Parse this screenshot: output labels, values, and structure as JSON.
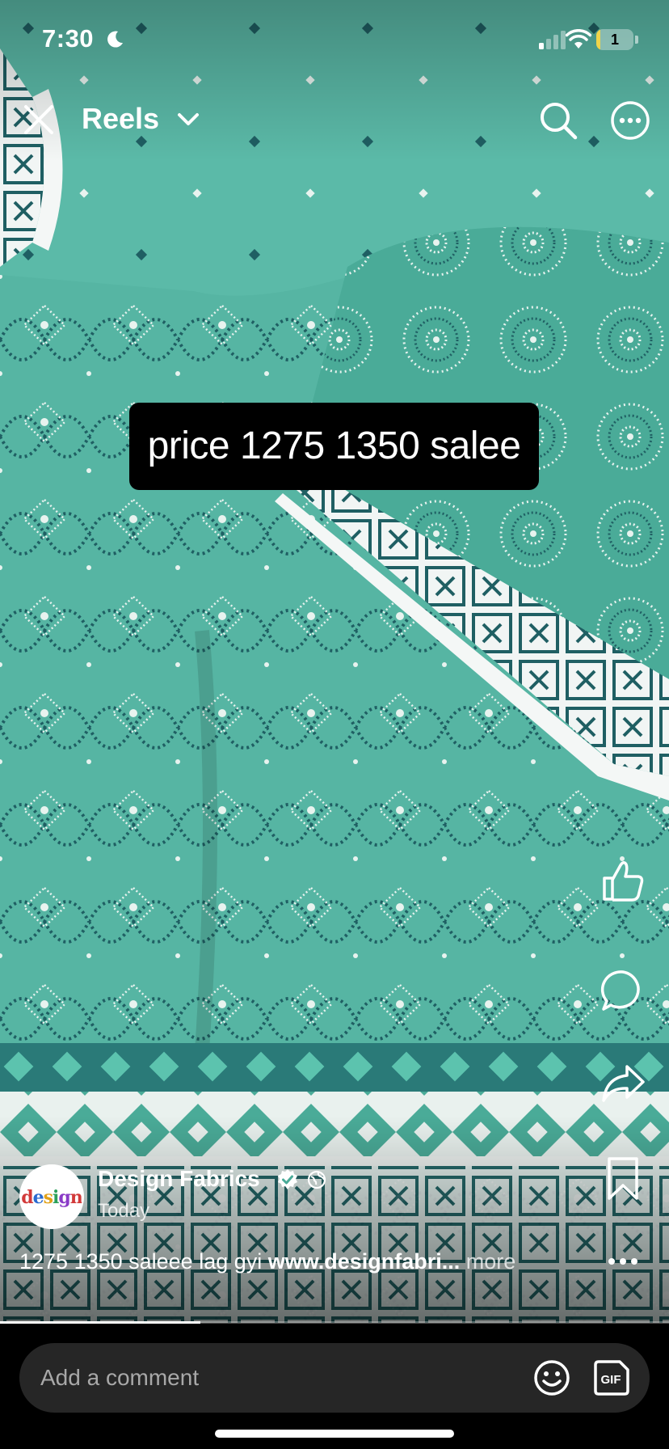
{
  "status_bar": {
    "time": "7:30",
    "battery": "1",
    "battery_level": 0.1,
    "icons": [
      "moon-icon",
      "cellular-signal-icon",
      "wifi-icon",
      "battery-icon"
    ]
  },
  "nav": {
    "title": "Reels",
    "icons": [
      "close-icon",
      "chevron-down-icon",
      "search-icon",
      "more-options-icon"
    ]
  },
  "video": {
    "overlay_text": "price 1275 1350 salee",
    "progress": 0.3
  },
  "actions": {
    "icons": [
      "like-icon",
      "comment-icon",
      "share-icon",
      "save-icon"
    ]
  },
  "author": {
    "name": "Design Fabrics",
    "time": "Today",
    "avatar_logo": "design",
    "icons": [
      "verified-badge-icon",
      "globe-icon"
    ]
  },
  "caption": {
    "text": "1275 1350 saleee lag gyi ",
    "link": "www.designfabri...",
    "more": "more"
  },
  "comment": {
    "placeholder": "Add a comment",
    "icons": [
      "emoji-icon",
      "gif-icon"
    ]
  },
  "colors": {
    "fabric_base": "#4fb09f",
    "fabric_dark": "#1f5f63",
    "fabric_light": "#e8f3ef",
    "comment_bar": "#262626",
    "battery": "#f0d44a"
  }
}
